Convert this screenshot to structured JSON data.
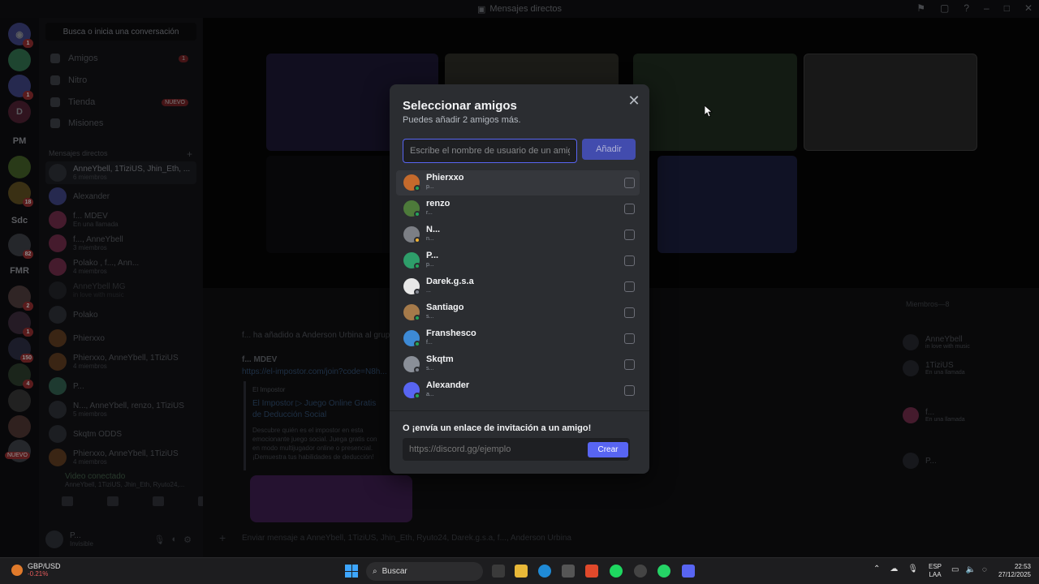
{
  "window": {
    "title": "Mensajes directos"
  },
  "rail": {
    "labels": [
      "PM",
      "Sdc",
      "FMR"
    ],
    "badges": [
      "1",
      "1",
      "18",
      "82",
      "2",
      "1",
      "150",
      "4"
    ],
    "new_label": "NUEVO"
  },
  "sidebar": {
    "search_placeholder": "Busca o inicia una conversación",
    "nav": [
      {
        "label": "Amigos",
        "badge": "1"
      },
      {
        "label": "Nitro",
        "badge": ""
      },
      {
        "label": "Tienda",
        "badge": "NUEVO"
      },
      {
        "label": "Misiones",
        "badge": ""
      }
    ],
    "dm_header": "Mensajes directos",
    "dms": [
      {
        "name": "AnneYbell, 1TiziUS, Jhin_Eth, ...",
        "sub": "6 miembros"
      },
      {
        "name": "Alexander",
        "sub": ""
      },
      {
        "name": "f... MDEV",
        "sub": "En una llamada"
      },
      {
        "name": "f..., AnneYbell",
        "sub": "3 miembros"
      },
      {
        "name": "Polako , f..., Ann...",
        "sub": "4 miembros"
      },
      {
        "name": "AnneYbell MG",
        "sub": "in love with music"
      },
      {
        "name": "Polako",
        "sub": ""
      },
      {
        "name": "Phierxxo",
        "sub": ""
      },
      {
        "name": "Phierxxo, AnneYbell, 1TiziUS",
        "sub": "4 miembros"
      },
      {
        "name": "P...",
        "sub": ""
      },
      {
        "name": "N..., AnneYbell, renzo, 1TiziUS",
        "sub": "5 miembros"
      },
      {
        "name": "Skqtm ODDS",
        "sub": ""
      },
      {
        "name": "Phierxxo, AnneYbell, 1TiziUS",
        "sub": "4 miembros"
      }
    ],
    "voice": {
      "title": "Video conectado",
      "sub": "AnneYbell, 1TiziUS, Jhin_Eth, Ryuto24,..."
    },
    "user": {
      "name": "P...",
      "status": "Invisible"
    }
  },
  "chat": {
    "system_line": "f... ha añadido a Anderson Urbina al grupo.",
    "message_author": "f... MDEV",
    "message_link": "https://el-impostor.com/join?code=N8h...",
    "embed_site": "El Impostor",
    "embed_title": "El Impostor ▷ Juego Online Gratis de Deducción Social",
    "embed_desc": "Descubre quién es el impostor en esta emocionante juego social. Juega gratis con en modo multijugador online o presencial. ¡Demuestra tus habilidades de deducción!",
    "composer_placeholder": "Enviar mensaje a AnneYbell, 1TiziUS, Jhin_Eth, Ryuto24, Darek.g.s.a, f..., Anderson Urbina"
  },
  "members": {
    "header": "Miembros—8",
    "list": [
      {
        "name": "AnneYbell",
        "sub": "in love with music"
      },
      {
        "name": "1TiziUS",
        "sub": "En una llamada"
      },
      {
        "name": "f...",
        "sub": "En una llamada"
      },
      {
        "name": "P...",
        "sub": ""
      }
    ]
  },
  "modal": {
    "title": "Seleccionar amigos",
    "subtitle": "Puedes añadir 2 amigos más.",
    "input_placeholder": "Escribe el nombre de usuario de un amigo",
    "add_label": "Añadir",
    "friends": [
      {
        "name": "Phierxxo",
        "sub": "p...",
        "color": "#c46a2c",
        "status": "online"
      },
      {
        "name": "renzo",
        "sub": "r...",
        "color": "#4d7a3a",
        "status": "online"
      },
      {
        "name": "N...",
        "sub": "n...",
        "color": "#7c7f85",
        "status": "idle"
      },
      {
        "name": "P...",
        "sub": "p...",
        "color": "#2e9e6a",
        "status": "online"
      },
      {
        "name": "Darek.g.s.a",
        "sub": "...",
        "color": "#e8e8e8",
        "status": "offline"
      },
      {
        "name": "Santiago",
        "sub": "s...",
        "color": "#a57a4a",
        "status": "online"
      },
      {
        "name": "Franshesco",
        "sub": "f...",
        "color": "#3d8ad6",
        "status": "online"
      },
      {
        "name": "Skqtm",
        "sub": "s...",
        "color": "#8a8f98",
        "status": "offline"
      },
      {
        "name": "Alexander",
        "sub": "a...",
        "color": "#5865f2",
        "status": "online"
      }
    ],
    "invite_title": "O ¡envía un enlace de invitación a un amigo!",
    "invite_placeholder": "https://discord.gg/ejemplo",
    "create_label": "Crear"
  },
  "taskbar": {
    "weather_symbol": "GBP/USD",
    "weather_value": "-0.21%",
    "search_label": "Buscar",
    "lang_top": "ESP",
    "lang_bottom": "LAA",
    "time": "22:53",
    "date": "27/12/2025"
  }
}
